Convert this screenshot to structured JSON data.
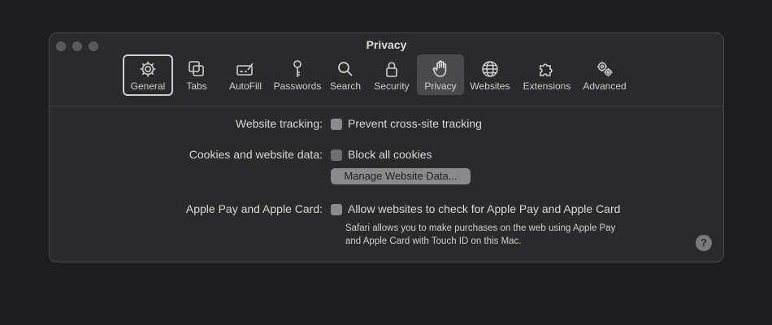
{
  "window": {
    "title": "Privacy"
  },
  "toolbar": {
    "items": [
      {
        "label": "General",
        "icon": "gear-icon"
      },
      {
        "label": "Tabs",
        "icon": "tabs-icon"
      },
      {
        "label": "AutoFill",
        "icon": "autofill-icon"
      },
      {
        "label": "Passwords",
        "icon": "key-icon"
      },
      {
        "label": "Search",
        "icon": "magnifier-icon"
      },
      {
        "label": "Security",
        "icon": "lock-icon"
      },
      {
        "label": "Privacy",
        "icon": "hand-icon"
      },
      {
        "label": "Websites",
        "icon": "globe-icon"
      },
      {
        "label": "Extensions",
        "icon": "puzzle-icon"
      },
      {
        "label": "Advanced",
        "icon": "gears-icon"
      }
    ]
  },
  "settings": {
    "tracking_label": "Website tracking:",
    "tracking_option": "Prevent cross-site tracking",
    "cookies_label": "Cookies and website data:",
    "cookies_option": "Block all cookies",
    "manage_button": "Manage Website Data...",
    "applepay_label": "Apple Pay and Apple Card:",
    "applepay_option": "Allow websites to check for Apple Pay and Apple Card",
    "applepay_note_line1": "Safari allows you to make purchases on the web using Apple Pay",
    "applepay_note_line2": "and Apple Card with Touch ID on this Mac."
  },
  "help": {
    "glyph": "?"
  }
}
